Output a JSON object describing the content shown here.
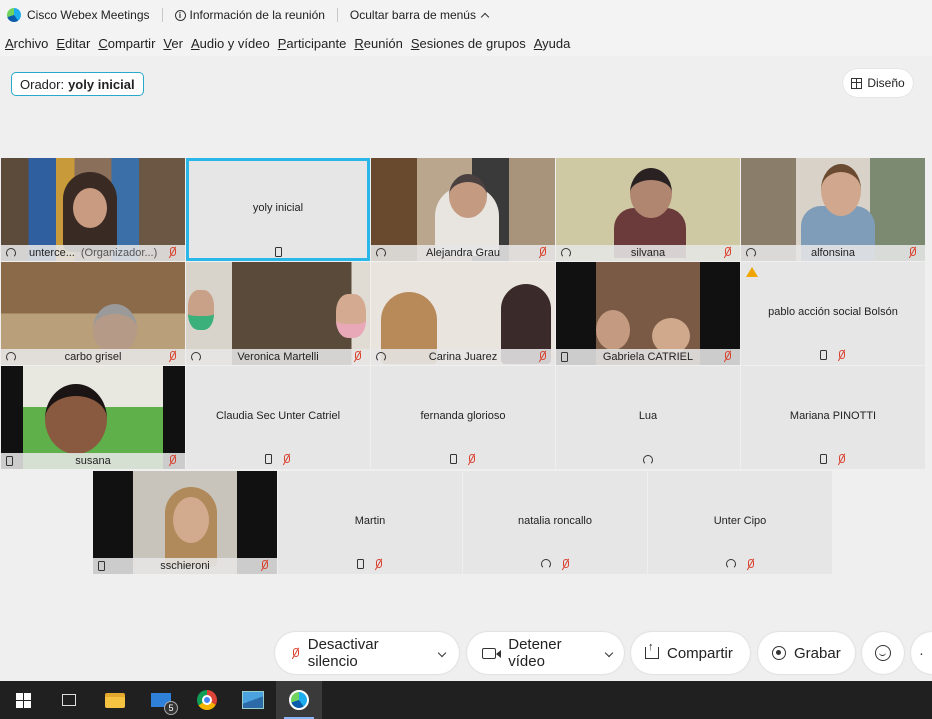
{
  "titlebar": {
    "app_name": "Cisco Webex Meetings",
    "meeting_info": "Información de la reunión",
    "hide_menu": "Ocultar barra de menús"
  },
  "menu": [
    "Archivo",
    "Editar",
    "Compartir",
    "Ver",
    "Audio y vídeo",
    "Participante",
    "Reunión",
    "Sesiones de grupos",
    "Ayuda"
  ],
  "speaker": {
    "label": "Orador:",
    "name": "yoly inicial"
  },
  "layout_button": "Diseño",
  "participants": {
    "p1": {
      "name": "unterce...",
      "role": "(Organizador...)"
    },
    "p2": {
      "name": "yoly inicial"
    },
    "p3": {
      "name": "Alejandra Grau"
    },
    "p4": {
      "name": "silvana"
    },
    "p5": {
      "name": "alfonsina"
    },
    "p6": {
      "name": "carbo grisel"
    },
    "p7": {
      "name": "Veronica Martelli"
    },
    "p8": {
      "name": "Carina Juarez"
    },
    "p9": {
      "name": "Gabriela CATRIEL"
    },
    "p10": {
      "name": "pablo acción social Bolsón"
    },
    "p11": {
      "name": "susana"
    },
    "p12": {
      "name": "Claudia Sec Unter Catriel"
    },
    "p13": {
      "name": "fernanda glorioso"
    },
    "p14": {
      "name": "Lua"
    },
    "p15": {
      "name": "Mariana PINOTTI"
    },
    "p16": {
      "name": "sschieroni"
    },
    "p17": {
      "name": "Martin"
    },
    "p18": {
      "name": "natalia roncallo"
    },
    "p19": {
      "name": "Unter Cipo"
    }
  },
  "controls": {
    "unmute": "Desactivar silencio",
    "stop_video": "Detener vídeo",
    "share": "Compartir",
    "record": "Grabar"
  },
  "taskbar": {
    "mail_badge": "5"
  },
  "colors": {
    "accent": "#29b6e8",
    "muted": "#d9412e",
    "warning": "#f0a500"
  }
}
